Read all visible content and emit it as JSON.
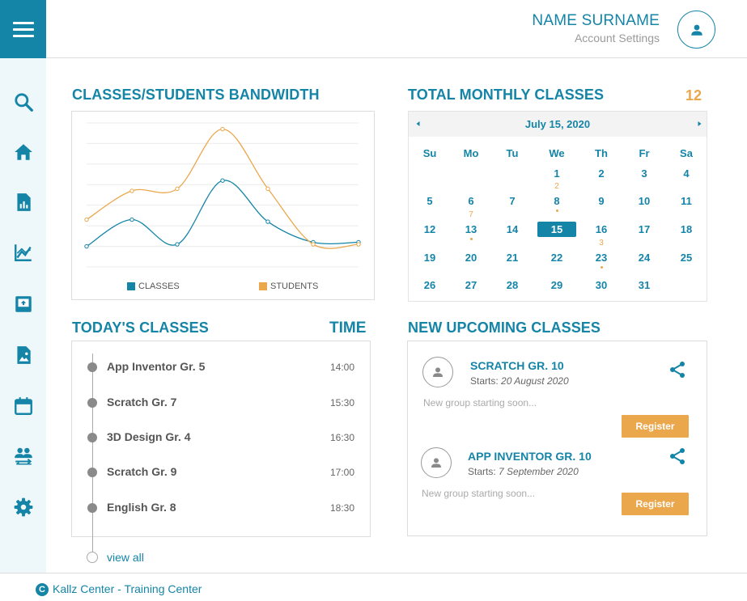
{
  "header": {
    "user_name": "NAME SURNAME",
    "account_link": "Account Settings"
  },
  "sidebar": {
    "items": [
      {
        "icon": "search-icon"
      },
      {
        "icon": "home-icon"
      },
      {
        "icon": "report-icon"
      },
      {
        "icon": "analytics-icon"
      },
      {
        "icon": "inbox-icon"
      },
      {
        "icon": "image-icon"
      },
      {
        "icon": "calendar-icon"
      },
      {
        "icon": "people-swap-icon"
      },
      {
        "icon": "settings-icon"
      }
    ]
  },
  "bandwidth": {
    "title": "CLASSES/STUDENTS  BANDWIDTH"
  },
  "chart_data": {
    "type": "line",
    "title": "CLASSES/STUDENTS  BANDWIDTH",
    "xlabel": "",
    "ylabel": "",
    "x": [
      1,
      2,
      3,
      4,
      5,
      6,
      7
    ],
    "ylim": [
      0,
      7
    ],
    "grid": true,
    "legend_position": "bottom",
    "series": [
      {
        "name": "CLASSES",
        "color": "#1484a7",
        "values": [
          1.0,
          2.3,
          1.1,
          4.2,
          2.2,
          1.2,
          1.2
        ]
      },
      {
        "name": "STUDENTS",
        "color": "#eba74c",
        "values": [
          2.3,
          3.7,
          3.8,
          6.7,
          3.8,
          1.1,
          1.1
        ]
      }
    ]
  },
  "monthly": {
    "title": "TOTAL MONTHLY CLASSES",
    "count": "12"
  },
  "calendar": {
    "month_label": "July 15, 2020",
    "weekdays": [
      "Su",
      "Mo",
      "Tu",
      "We",
      "Th",
      "Fr",
      "Sa"
    ],
    "first_weekday": 3,
    "days_in_month": 31,
    "selected_day": 15,
    "counts": {
      "8": "2",
      "13": "7",
      "23": "3"
    }
  },
  "today": {
    "title": "TODAY'S CLASSES",
    "time_title": "TIME",
    "classes": [
      {
        "name": "App Inventor Gr. 5",
        "time": "14:00"
      },
      {
        "name": "Scratch Gr. 7",
        "time": "15:30"
      },
      {
        "name": "3D Design Gr. 4",
        "time": "16:30"
      },
      {
        "name": "Scratch Gr. 9",
        "time": "17:00"
      },
      {
        "name": "English Gr. 8",
        "time": "18:30"
      }
    ],
    "view_all": "view all"
  },
  "upcoming": {
    "title": "NEW UPCOMING CLASSES",
    "items": [
      {
        "title": "SCRATCH  GR. 10",
        "starts_label": "Starts:",
        "starts_date": "20 August 2020",
        "description": "New group starting soon...",
        "button": "Register"
      },
      {
        "title": "APP INVENTOR GR. 10",
        "starts_label": "Starts:",
        "starts_date": "7 September 2020",
        "description": "New group starting soon...",
        "button": "Register"
      }
    ]
  },
  "footer": {
    "logo_letter": "C",
    "text": "Kallz Center - Training Center"
  }
}
